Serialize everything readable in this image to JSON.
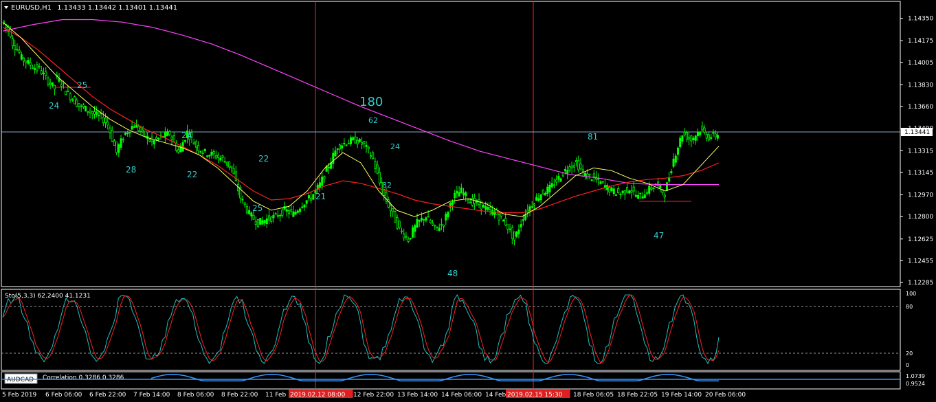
{
  "header": {
    "symbol": "EURUSD,H1",
    "ohlc": "1.13433 1.13442 1.13401 1.13441"
  },
  "colors": {
    "background": "#000000",
    "frame": "#ffffff",
    "candle_up": "#00ff00",
    "candle_down": "#00ff00",
    "ma_fast": "#ffff66",
    "ma_mid": "#ff2020",
    "ma_slow": "#ff44ff",
    "cyan_label": "#33cccc",
    "vline": "#ff2222",
    "bid_line": "#8aa6c6",
    "stoch_main": "#20c0c0",
    "stoch_signal": "#ff2020",
    "corr": "#3399ff",
    "axis_text": "#ffffff"
  },
  "price_axis": {
    "ticks": [
      "1.14350",
      "1.14175",
      "1.14005",
      "1.13830",
      "1.13660",
      "1.13490",
      "1.13315",
      "1.13145",
      "1.12970",
      "1.12800",
      "1.12625",
      "1.12455",
      "1.12285"
    ],
    "current_price": "1.13441"
  },
  "time_axis": {
    "labels": [
      "5 Feb 2019",
      "6 Feb 06:00",
      "6 Feb 22:00",
      "7 Feb 14:00",
      "8 Feb 06:00",
      "8 Feb 22:00",
      "11 Feb",
      "2019.02.12 08:00",
      "12 Feb 22:00",
      "13 Feb 14:00",
      "14 Feb 06:00",
      "14 Feb",
      "2019.02.15 15:30",
      "18 Feb 06:05",
      "18 Feb 22:05",
      "19 Feb 14:00",
      "20 Feb 06:00"
    ],
    "highlighted": [
      "2019.02.12 08:00",
      "2019.02.15 15:30"
    ]
  },
  "annotations": [
    {
      "text": "24"
    },
    {
      "text": "25"
    },
    {
      "text": "28"
    },
    {
      "text": "24"
    },
    {
      "text": "22"
    },
    {
      "text": "22"
    },
    {
      "text": "25"
    },
    {
      "text": "21"
    },
    {
      "text": "180"
    },
    {
      "text": "62"
    },
    {
      "text": "24"
    },
    {
      "text": "82"
    },
    {
      "text": "48"
    },
    {
      "text": "81"
    },
    {
      "text": "47"
    }
  ],
  "stochastic": {
    "label": "Sto(5,3,3) 62.2400 41.1231",
    "levels": [
      "100",
      "80",
      "20",
      "0"
    ]
  },
  "correlation": {
    "badge": "AUDCAD",
    "label": "Correlation 0.3286 0.3286",
    "axis": [
      "1.0739",
      "0.9524"
    ]
  },
  "chart_data": {
    "type": "candlestick",
    "symbol": "EURUSD",
    "timeframe": "H1",
    "ylim": [
      1.1228,
      1.1445
    ],
    "close_path": [
      [
        1.1433,
        1.1423
      ],
      [
        1.1418,
        1.1408
      ],
      [
        1.1405,
        1.14
      ],
      [
        1.14,
        1.1395
      ],
      [
        1.1398,
        1.1388
      ],
      [
        1.1388,
        1.138
      ],
      [
        1.139,
        1.1382
      ],
      [
        1.138,
        1.1372
      ],
      [
        1.1372,
        1.1365
      ],
      [
        1.1366,
        1.1362
      ],
      [
        1.1362,
        1.1358
      ],
      [
        1.136,
        1.1352
      ],
      [
        1.1352,
        1.133
      ],
      [
        1.1332,
        1.1345
      ],
      [
        1.1345,
        1.1352
      ],
      [
        1.1352,
        1.1345
      ],
      [
        1.1345,
        1.1338
      ],
      [
        1.1338,
        1.1342
      ],
      [
        1.1342,
        1.1345
      ],
      [
        1.1345,
        1.133
      ],
      [
        1.133,
        1.1346
      ],
      [
        1.1346,
        1.1335
      ],
      [
        1.1335,
        1.133
      ],
      [
        1.133,
        1.1328
      ],
      [
        1.1328,
        1.1325
      ],
      [
        1.1325,
        1.1318
      ],
      [
        1.1318,
        1.1295
      ],
      [
        1.1295,
        1.1282
      ],
      [
        1.1282,
        1.1275
      ],
      [
        1.1275,
        1.1278
      ],
      [
        1.1278,
        1.128
      ],
      [
        1.128,
        1.1285
      ],
      [
        1.1285,
        1.1282
      ],
      [
        1.1282,
        1.129
      ],
      [
        1.129,
        1.1295
      ],
      [
        1.1295,
        1.1305
      ],
      [
        1.1305,
        1.132
      ],
      [
        1.132,
        1.1335
      ],
      [
        1.1335,
        1.1338
      ],
      [
        1.1338,
        1.134
      ],
      [
        1.134,
        1.1336
      ],
      [
        1.1336,
        1.1325
      ],
      [
        1.1325,
        1.13
      ],
      [
        1.13,
        1.1285
      ],
      [
        1.1285,
        1.127
      ],
      [
        1.127,
        1.1262
      ],
      [
        1.1262,
        1.1275
      ],
      [
        1.1275,
        1.128
      ],
      [
        1.128,
        1.127
      ],
      [
        1.127,
        1.1275
      ],
      [
        1.1275,
        1.1295
      ],
      [
        1.1295,
        1.13
      ],
      [
        1.13,
        1.1292
      ],
      [
        1.1292,
        1.129
      ],
      [
        1.129,
        1.1285
      ],
      [
        1.1285,
        1.1282
      ],
      [
        1.1282,
        1.1275
      ],
      [
        1.1275,
        1.1262
      ],
      [
        1.1262,
        1.128
      ],
      [
        1.128,
        1.129
      ],
      [
        1.129,
        1.1298
      ],
      [
        1.1298,
        1.1302
      ],
      [
        1.1302,
        1.131
      ],
      [
        1.131,
        1.1318
      ],
      [
        1.1318,
        1.1322
      ],
      [
        1.1322,
        1.1312
      ],
      [
        1.1312,
        1.131
      ],
      [
        1.131,
        1.1305
      ],
      [
        1.1305,
        1.13
      ],
      [
        1.13,
        1.1298
      ],
      [
        1.1298,
        1.1302
      ],
      [
        1.1302,
        1.1295
      ],
      [
        1.1295,
        1.13
      ],
      [
        1.13,
        1.1305
      ],
      [
        1.1305,
        1.1298
      ],
      [
        1.1298,
        1.1325
      ],
      [
        1.1325,
        1.1345
      ],
      [
        1.1345,
        1.134
      ],
      [
        1.134,
        1.1348
      ],
      [
        1.1348,
        1.1342
      ],
      [
        1.1342,
        1.1344
      ]
    ],
    "ma_fast_path": [
      1.1432,
      1.142,
      1.1405,
      1.139,
      1.1378,
      1.1366,
      1.1356,
      1.1348,
      1.1342,
      1.1338,
      1.1334,
      1.1328,
      1.1318,
      1.1305,
      1.1292,
      1.1285,
      1.1288,
      1.13,
      1.1318,
      1.133,
      1.1322,
      1.13,
      1.1285,
      1.128,
      1.1285,
      1.1292,
      1.1294,
      1.129,
      1.1282,
      1.128,
      1.1288,
      1.13,
      1.1312,
      1.1318,
      1.1316,
      1.131,
      1.1306,
      1.13,
      1.1305,
      1.132,
      1.1335
    ],
    "ma_mid_path": [
      1.1428,
      1.142,
      1.141,
      1.1398,
      1.1386,
      1.1374,
      1.1364,
      1.1356,
      1.1348,
      1.1342,
      1.1335,
      1.1328,
      1.132,
      1.131,
      1.13,
      1.1293,
      1.1294,
      1.1298,
      1.1304,
      1.1308,
      1.1306,
      1.1302,
      1.1298,
      1.1293,
      1.129,
      1.1288,
      1.1286,
      1.1284,
      1.1283,
      1.1283,
      1.1286,
      1.1291,
      1.1296,
      1.13,
      1.1304,
      1.1307,
      1.1309,
      1.131,
      1.1312,
      1.1316,
      1.1322
    ],
    "ma_slow_path": [
      1.1425,
      1.143,
      1.1434,
      1.1434,
      1.1432,
      1.1428,
      1.1422,
      1.1415,
      1.1406,
      1.1396,
      1.1386,
      1.1376,
      1.1366,
      1.1357,
      1.1348,
      1.1339,
      1.1331,
      1.1325,
      1.1319,
      1.1313,
      1.131,
      1.1306,
      1.1305,
      1.1305,
      1.1305
    ]
  }
}
